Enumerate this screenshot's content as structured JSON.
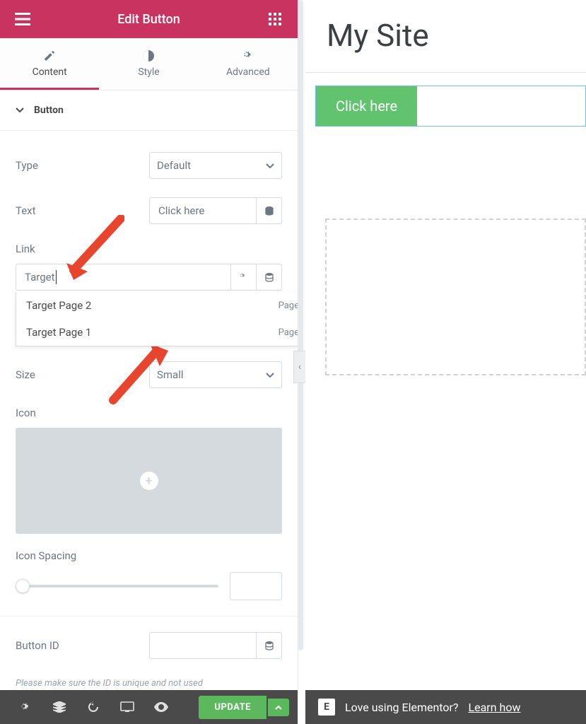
{
  "header": {
    "title": "Edit Button"
  },
  "tabs": [
    {
      "label": "Content",
      "active": true
    },
    {
      "label": "Style",
      "active": false
    },
    {
      "label": "Advanced",
      "active": false
    }
  ],
  "section": {
    "title": "Button"
  },
  "controls": {
    "type": {
      "label": "Type",
      "value": "Default"
    },
    "text": {
      "label": "Text",
      "value": "Click here"
    },
    "link": {
      "label": "Link",
      "value": "Target",
      "suggestions": [
        {
          "title": "Target Page 2",
          "type": "Page"
        },
        {
          "title": "Target Page 1",
          "type": "Page"
        }
      ]
    },
    "size": {
      "label": "Size",
      "value": "Small"
    },
    "icon": {
      "label": "Icon"
    },
    "icon_spacing": {
      "label": "Icon Spacing",
      "value": ""
    },
    "button_id": {
      "label": "Button ID",
      "value": "",
      "note": "Please make sure the ID is unique and not used"
    }
  },
  "footer": {
    "update": "UPDATE"
  },
  "preview": {
    "site_title": "My Site",
    "button_label": "Click here"
  },
  "promo": {
    "text": "Love using Elementor?",
    "link": "Learn how"
  },
  "colors": {
    "brand": "#c93360",
    "accent": "#5cb85c",
    "preview_btn": "#61c36e"
  }
}
